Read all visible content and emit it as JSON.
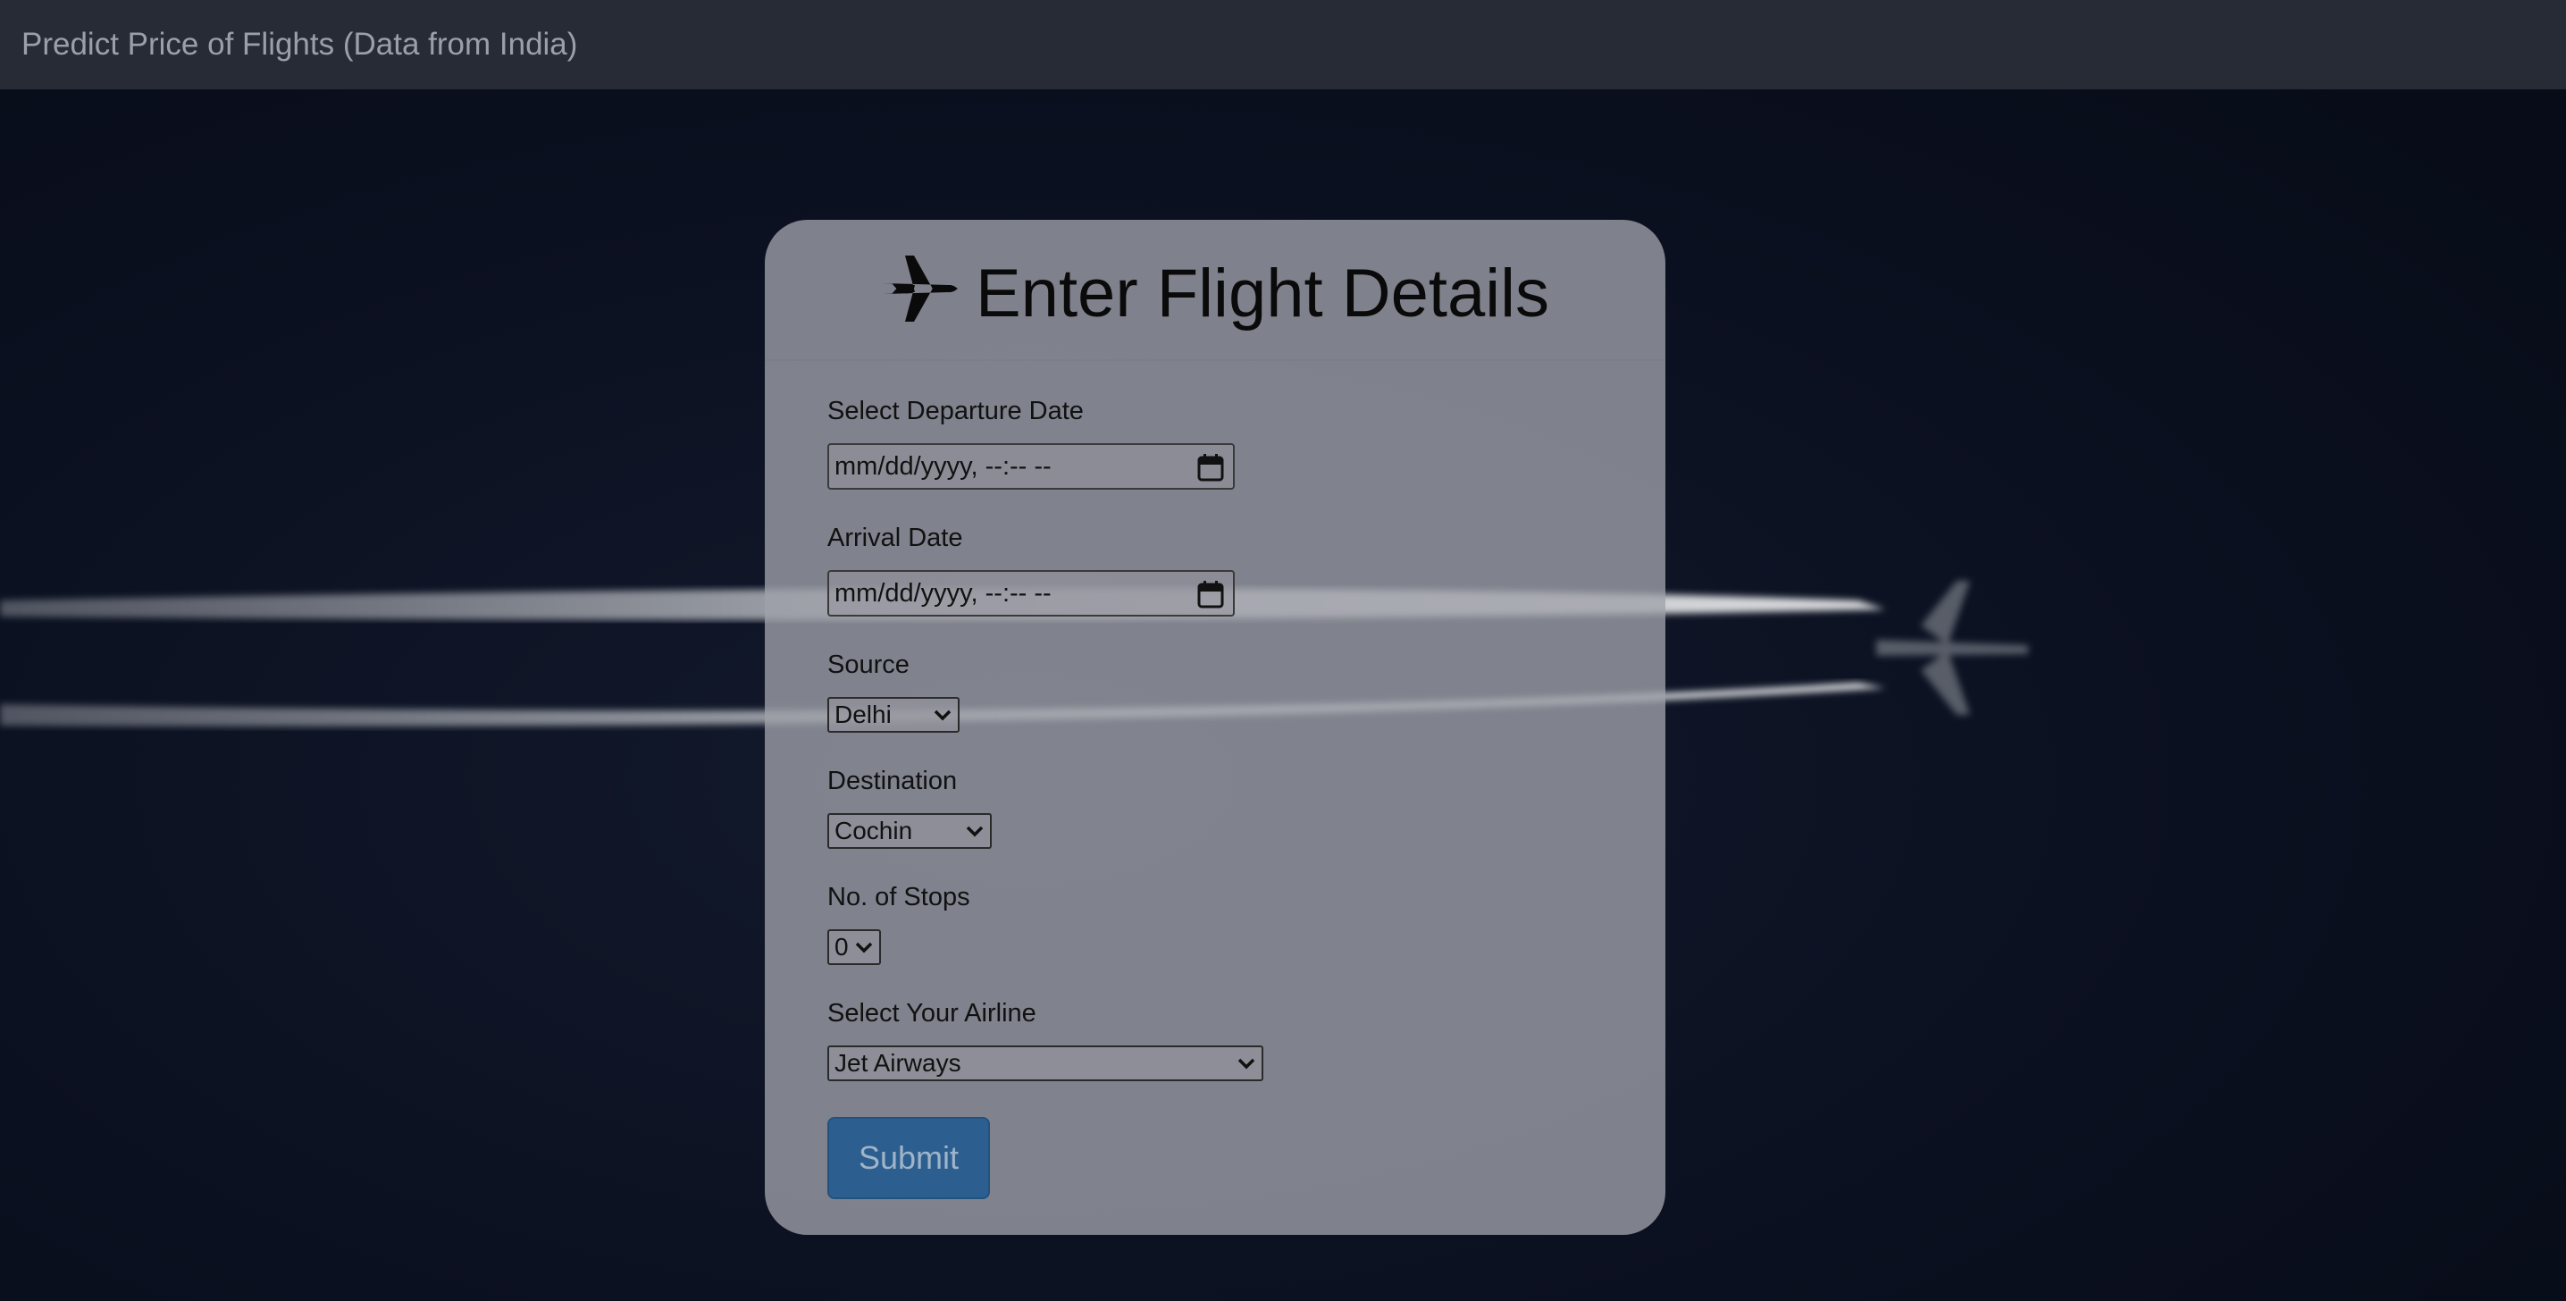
{
  "navbar": {
    "brand": "Predict Price of Flights (Data from India)"
  },
  "form": {
    "title": "Enter Flight Details",
    "title_icon": "airplane-icon",
    "departure": {
      "label": "Select Departure Date",
      "placeholder": "mm/dd/yyyy, --:-- --",
      "icon": "calendar-icon"
    },
    "arrival": {
      "label": "Arrival Date",
      "placeholder": "mm/dd/yyyy, --:-- --",
      "icon": "calendar-icon"
    },
    "source": {
      "label": "Source",
      "selected": "Delhi"
    },
    "destination": {
      "label": "Destination",
      "selected": "Cochin"
    },
    "stops": {
      "label": "No. of Stops",
      "selected": "0"
    },
    "airline": {
      "label": "Select Your Airline",
      "selected": "Jet Airways"
    },
    "submit_label": "Submit"
  },
  "colors": {
    "navbar_bg": "#272b35",
    "page_bg": "#0c1220",
    "card_bg": "#a0a2aa",
    "submit_bg": "#2c5f90"
  }
}
